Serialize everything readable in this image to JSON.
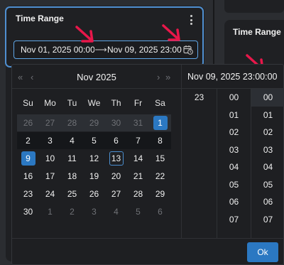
{
  "right_panel": {
    "title": "Time Range"
  },
  "card": {
    "title": "Time Range",
    "start_value": "Nov 01, 2025 00:00",
    "separator": "⟶",
    "end_value": "Nov 09, 2025 23:00"
  },
  "calendar": {
    "month_label": "Nov 2025",
    "prev_year": "«",
    "prev_month": "‹",
    "next_month": "›",
    "next_year": "»",
    "weekdays": [
      "Su",
      "Mo",
      "Tu",
      "We",
      "Th",
      "Fr",
      "Sa"
    ],
    "weeks": [
      [
        "26",
        "27",
        "28",
        "29",
        "30",
        "31",
        "1"
      ],
      [
        "2",
        "3",
        "4",
        "5",
        "6",
        "7",
        "8"
      ],
      [
        "9",
        "10",
        "11",
        "12",
        "13",
        "14",
        "15"
      ],
      [
        "16",
        "17",
        "18",
        "19",
        "20",
        "21",
        "22"
      ],
      [
        "23",
        "24",
        "25",
        "26",
        "27",
        "28",
        "29"
      ],
      [
        "30",
        "1",
        "2",
        "3",
        "4",
        "5",
        "6"
      ]
    ]
  },
  "time_panel": {
    "header": "Nov 09, 2025 23:00:00",
    "hours": [
      "23"
    ],
    "minutes": [
      "00",
      "01",
      "02",
      "03",
      "04",
      "05",
      "06",
      "07"
    ],
    "seconds": [
      "00",
      "01",
      "02",
      "03",
      "04",
      "05",
      "06",
      "07"
    ]
  },
  "footer": {
    "ok_label": "Ok"
  },
  "colors": {
    "accent": "#2b78c2",
    "annotation": "#e8174a"
  }
}
